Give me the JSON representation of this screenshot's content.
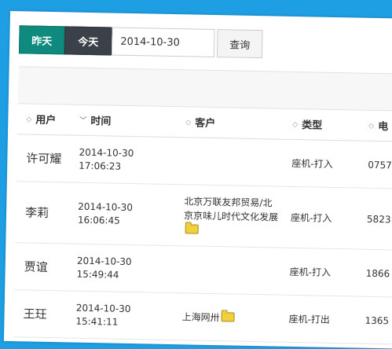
{
  "toolbar": {
    "yesterday_label": "昨天",
    "today_label": "今天",
    "date_value": "2014-10-30",
    "query_label": "查询"
  },
  "table": {
    "columns": [
      "用户",
      "时间",
      "客户",
      "类型",
      "电"
    ],
    "rows": [
      {
        "user": "许可耀",
        "date": "2014-10-30",
        "time": "17:06:23",
        "client": "",
        "client_folder": false,
        "type": "座机-打入",
        "phone": "0757"
      },
      {
        "user": "李莉",
        "date": "2014-10-30",
        "time": "16:06:45",
        "client": "北京万联友邦贸易/北京京味儿时代文化发展",
        "client_folder": true,
        "type": "座机-打入",
        "phone": "5823"
      },
      {
        "user": "贾谊",
        "date": "2014-10-30",
        "time": "15:49:44",
        "client": "",
        "client_folder": false,
        "type": "座机-打入",
        "phone": "1866"
      },
      {
        "user": "王玨",
        "date": "2014-10-30",
        "time": "15:41:11",
        "client": "上海网卅",
        "client_folder": true,
        "type": "座机-打出",
        "phone": "1365"
      }
    ]
  },
  "icons": {
    "sort": "sort-icon",
    "sort_desc": "chevron-down-icon",
    "folder": "folder-icon"
  }
}
